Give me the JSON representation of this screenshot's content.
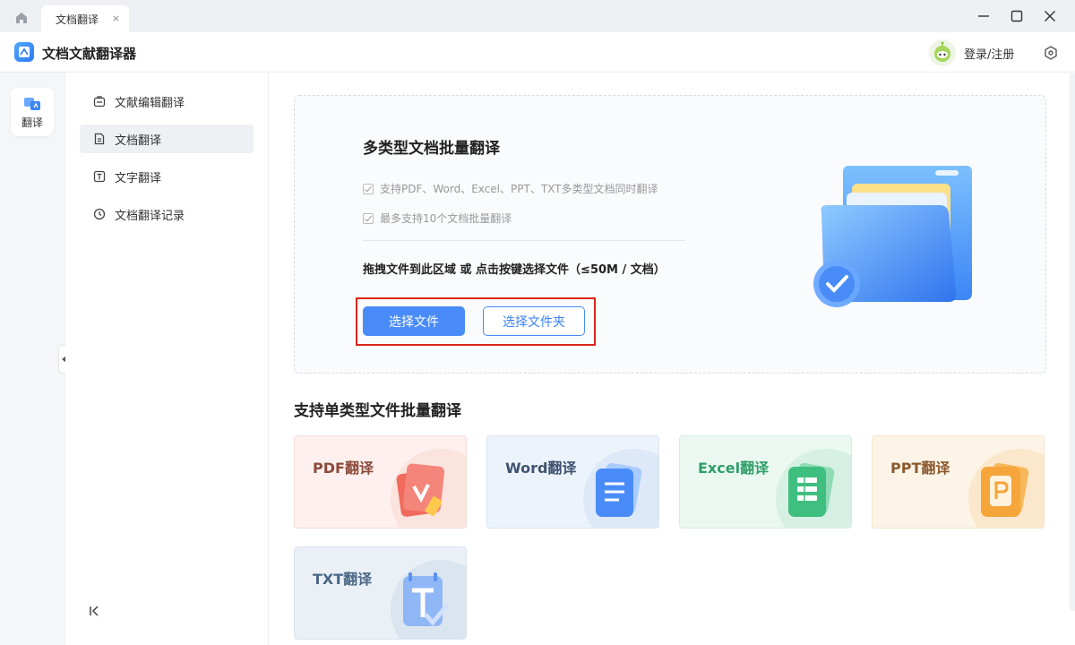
{
  "tabbar": {
    "active_tab": "文档翻译",
    "close_glyph": "×"
  },
  "appbar": {
    "title": "文档文献翻译器",
    "login": "登录/注册"
  },
  "rail": {
    "item_label": "翻译"
  },
  "menu": {
    "items": [
      {
        "label": "文献编辑翻译",
        "icon": "briefcase-icon"
      },
      {
        "label": "文档翻译",
        "icon": "document-icon"
      },
      {
        "label": "文字翻译",
        "icon": "text-icon"
      },
      {
        "label": "文档翻译记录",
        "icon": "clock-icon"
      }
    ],
    "active_index": 1
  },
  "dropzone": {
    "title": "多类型文档批量翻译",
    "features": [
      "支持PDF、Word、Excel、PPT、TXT多类型文档同时翻译",
      "最多支持10个文档批量翻译"
    ],
    "hint": "拖拽文件到此区域 或 点击按键选择文件（≤50M / 文档）",
    "select_file": "选择文件",
    "select_folder": "选择文件夹"
  },
  "section": {
    "title": "支持单类型文件批量翻译",
    "cards": [
      {
        "label": "PDF翻译",
        "color": "#8a4b3a",
        "bg": "#fdf0ee",
        "accent": "#f06b5d"
      },
      {
        "label": "Word翻译",
        "color": "#3f5370",
        "bg": "#edf3fb",
        "accent": "#4a8cf7"
      },
      {
        "label": "Excel翻译",
        "color": "#2f9e68",
        "bg": "#eaf8f1",
        "accent": "#3fbf7f"
      },
      {
        "label": "PPT翻译",
        "color": "#8a5a2e",
        "bg": "#fdf4e8",
        "accent": "#f5a53a"
      },
      {
        "label": "TXT翻译",
        "color": "#4a6685",
        "bg": "#eaf0f6",
        "accent": "#5b8ff0"
      }
    ]
  }
}
